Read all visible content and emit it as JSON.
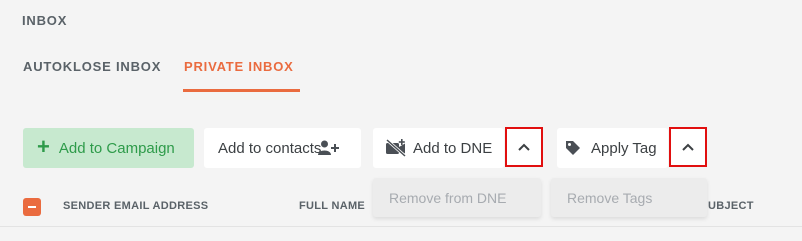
{
  "section": {
    "title": "INBOX"
  },
  "tabs": [
    {
      "label": "AUTOKLOSE INBOX",
      "active": false
    },
    {
      "label": "PRIVATE INBOX",
      "active": true
    }
  ],
  "toolbar": {
    "add_to_campaign": "Add to Campaign",
    "add_to_contacts": "Add to contacts",
    "add_to_dne": "Add to DNE",
    "apply_tag": "Apply Tag"
  },
  "dropdowns": {
    "dne": {
      "item": "Remove from DNE"
    },
    "tag": {
      "item": "Remove Tags"
    }
  },
  "table": {
    "columns": [
      "SENDER EMAIL ADDRESS",
      "FULL NAME",
      "SUBJECT"
    ],
    "visible_subject_fragment": "UBJECT"
  },
  "colors": {
    "accent": "#ea6b3f",
    "campaign_bg": "#c7e9cf",
    "campaign_text": "#2e9b4a",
    "highlight_border": "#e10f0f"
  },
  "icons": {
    "campaign": "plus-icon",
    "contacts": "add-user-icon",
    "dne": "video-off-icon",
    "tag": "tag-icon",
    "caret": "chevron-up-icon"
  }
}
